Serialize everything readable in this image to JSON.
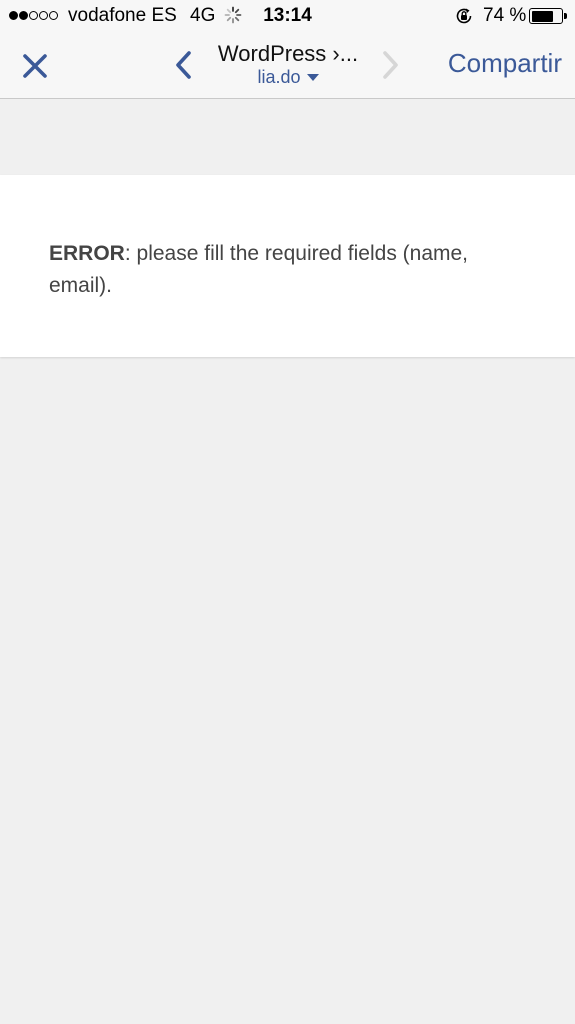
{
  "status_bar": {
    "signal_strength": "2 of 5",
    "carrier": "vodafone ES",
    "network": "4G",
    "time": "13:14",
    "battery_percent": "74 %",
    "battery_level": 0.74,
    "icons": [
      "signal-dots-icon",
      "activity-spinner-icon",
      "orientation-lock-icon",
      "battery-icon"
    ]
  },
  "nav": {
    "title": "WordPress ›...",
    "domain": "lia.do",
    "share_label": "Compartir",
    "accent_color": "#3b5998",
    "icons": [
      "close-icon",
      "back-chevron-icon",
      "forward-chevron-icon",
      "dropdown-caret-icon"
    ]
  },
  "content": {
    "error_label": "ERROR",
    "error_text": ": please fill the required fields (name, email)."
  }
}
